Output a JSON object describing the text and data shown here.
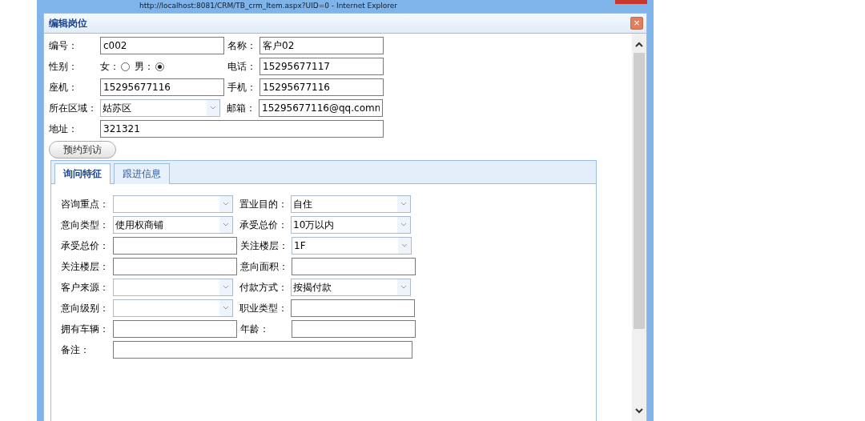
{
  "browser": {
    "title": "http://localhost:8081/CRM/TB_crm_Item.aspx?UID=0 - Internet Explorer"
  },
  "dialog": {
    "title": "编辑岗位",
    "close": "×"
  },
  "form": {
    "rows": [
      {
        "kind": "pair",
        "left": {
          "label": "编号：",
          "value": "c002",
          "kind": "input"
        },
        "right": {
          "label": "名称：",
          "value": "客户02",
          "kind": "input"
        }
      },
      {
        "kind": "gender",
        "label": "性别：",
        "options": [
          {
            "label": "女：",
            "selected": false
          },
          {
            "label": "男：",
            "selected": true
          }
        ],
        "right": {
          "label": "电话：",
          "value": "15295677117",
          "kind": "input"
        }
      },
      {
        "kind": "pair",
        "left": {
          "label": "座机：",
          "value": "15295677116",
          "kind": "input"
        },
        "right": {
          "label": "手机：",
          "value": "15295677116",
          "kind": "input"
        }
      },
      {
        "kind": "pair",
        "left": {
          "label": "所在区域：",
          "value": "姑苏区",
          "kind": "select"
        },
        "right": {
          "label": "邮箱：",
          "value": "15295677116@qq.comn",
          "kind": "input"
        }
      },
      {
        "kind": "wide",
        "left": {
          "label": "地址：",
          "value": "321321"
        }
      }
    ]
  },
  "appointment_button": "预约到访",
  "tabs": [
    {
      "label": "询问特征",
      "selected": true
    },
    {
      "label": "跟进信息",
      "selected": false
    }
  ],
  "features": [
    {
      "left": {
        "label": "咨询重点：",
        "kind": "select"
      },
      "right": {
        "label": "置业目的：",
        "kind": "select",
        "value": "自住"
      }
    },
    {
      "left": {
        "label": "意向类型：",
        "kind": "select",
        "value": "使用权商铺"
      },
      "right": {
        "label": "承受总价：",
        "kind": "select",
        "value": "10万以内"
      }
    },
    {
      "left": {
        "label": "承受总价：",
        "kind": "input"
      },
      "right": {
        "label": "关注楼层：",
        "kind": "select",
        "value": "1F"
      }
    },
    {
      "left": {
        "label": "关注楼层：",
        "kind": "input"
      },
      "right": {
        "label": "意向面积：",
        "kind": "input"
      }
    },
    {
      "left": {
        "label": "客户来源：",
        "kind": "select"
      },
      "right": {
        "label": "付款方式：",
        "kind": "select",
        "value": "按揭付款"
      }
    },
    {
      "left": {
        "label": "意向级别：",
        "kind": "select"
      },
      "right": {
        "label": "职业类型：",
        "kind": "input"
      }
    },
    {
      "left": {
        "label": "拥有车辆：",
        "kind": "input"
      },
      "right": {
        "label": "年龄：",
        "kind": "input"
      }
    },
    {
      "left": {
        "label": "备注：",
        "kind": "wide"
      }
    }
  ]
}
